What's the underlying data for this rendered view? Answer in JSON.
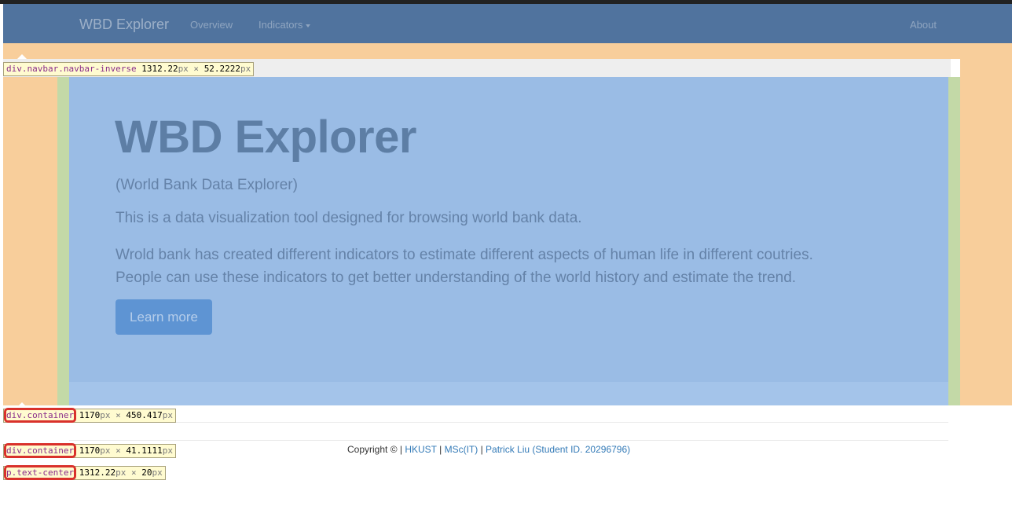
{
  "navbar": {
    "brand": "WBD Explorer",
    "links": {
      "overview": "Overview",
      "indicators": "Indicators",
      "about": "About"
    }
  },
  "jumbotron": {
    "title": "WBD Explorer",
    "subtitle": "(World Bank Data Explorer)",
    "paragraph1": "This is a data visualization tool designed for browsing world bank data.",
    "paragraph2_line1": "Wrold bank has created different indicators to estimate different aspects of human life in different coutries.",
    "paragraph2_line2": "People can use these indicators to get better understanding of the world history and estimate the trend.",
    "button": "Learn more"
  },
  "footer": {
    "copyright": "Copyright © | ",
    "link_hkust": "HKUST",
    "sep1": " | ",
    "link_msc": "MSc(IT)",
    "sep2": " | ",
    "link_author": "Patrick Liu (Student ID. 20296796)"
  },
  "inspector_tags": {
    "navbar": {
      "selector": "div.navbar.navbar-inverse",
      "w": "1312.22",
      "x": " × ",
      "h": "52.2222",
      "unit": "px"
    },
    "container1": {
      "selector": "div.container",
      "w": "1170",
      "x": " × ",
      "h": "450.417",
      "unit": "px"
    },
    "container2": {
      "selector": "div.container",
      "w": "1170",
      "x": " × ",
      "h": "41.1111",
      "unit": "px"
    },
    "text_center": {
      "selector": "p.text-center",
      "w": "1312.22",
      "x": " × ",
      "h": "20",
      "unit": "px"
    }
  },
  "colors": {
    "navbar": "#50739e",
    "margin_overlay": "#f8ce9b",
    "padding_overlay": "#c3d9a7",
    "content_overlay": "#9abce5",
    "button": "#5e94d3",
    "link": "#337ab7",
    "highlight_outline": "#d9312b"
  }
}
